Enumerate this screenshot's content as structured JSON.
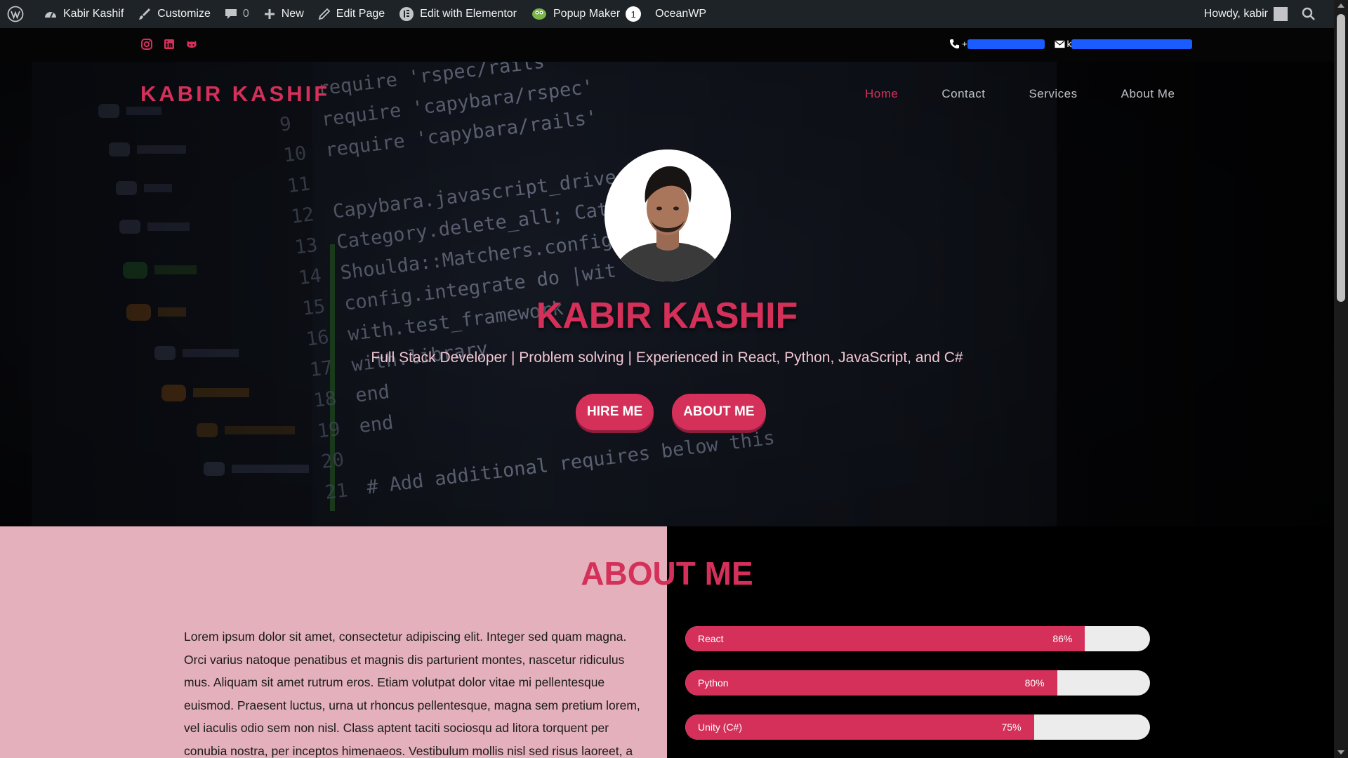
{
  "adminbar": {
    "site_name": "Kabir Kashif",
    "customize": "Customize",
    "comments_count": "0",
    "new": "New",
    "edit_page": "Edit Page",
    "edit_elementor": "Edit with Elementor",
    "popup_maker": "Popup Maker",
    "popup_count": "1",
    "oceanwp": "OceanWP",
    "howdy": "Howdy, kabir",
    "icons": [
      "wordpress-icon",
      "dashboard-icon",
      "brush-icon",
      "comment-icon",
      "plus-icon",
      "pencil-icon",
      "elementor-icon",
      "popup-maker-icon",
      "search-icon"
    ]
  },
  "topbar": {
    "social_icons": [
      "instagram-icon",
      "linkedin-icon",
      "github-icon"
    ],
    "phone_prefix": "+",
    "email_prefix": "k"
  },
  "header": {
    "brand": "KABIR KASHIF",
    "nav": [
      {
        "label": "Home",
        "active": true
      },
      {
        "label": "Contact",
        "active": false
      },
      {
        "label": "Services",
        "active": false
      },
      {
        "label": "About Me",
        "active": false
      }
    ]
  },
  "hero": {
    "title": "KABIR KASHIF",
    "subtitle": "Full Stack Developer | Problem solving | Experienced in React, Python, JavaScript, and C#",
    "hire_button": "HIRE ME",
    "about_button": "ABOUT ME",
    "code_lines": [
      {
        "num": "",
        "text": "require 'rspec/rails'"
      },
      {
        "num": "9",
        "text": "require 'capybara/rspec'"
      },
      {
        "num": "10",
        "text": "require 'capybara/rails'"
      },
      {
        "num": "11",
        "text": ""
      },
      {
        "num": "12",
        "text": "Capybara.javascript_driver = :w"
      },
      {
        "num": "13",
        "text": "Category.delete_all; Category"
      },
      {
        "num": "14",
        "text": "Shoulda::Matchers.configure do"
      },
      {
        "num": "15",
        "text": "config.integrate do |wit"
      },
      {
        "num": "16",
        "text": "with.test_framework"
      },
      {
        "num": "17",
        "text": "with.library"
      },
      {
        "num": "18",
        "text": "end"
      },
      {
        "num": "19",
        "text": "end"
      },
      {
        "num": "20",
        "text": ""
      },
      {
        "num": "21",
        "text": "# Add additional requires below this"
      }
    ]
  },
  "about": {
    "title": "ABOUT ME",
    "text": "Lorem ipsum dolor sit amet, consectetur adipiscing elit. Integer sed quam magna. Orci varius natoque penatibus et magnis dis parturient montes, nascetur ridiculus mus. Aliquam sit amet rutrum eros. Etiam volutpat dolor vitae mi pellentesque euismod. Praesent luctus, urna ut rhoncus pellentesque, magna sem pretium lorem, vel iaculis odio sem non nisl. Class aptent taciti sociosqu ad litora torquent per conubia nostra, per inceptos himenaeos. Vestibulum mollis nisl sed risus laoreet, a",
    "skills": [
      {
        "name": "React",
        "percent": 86,
        "label": "86%"
      },
      {
        "name": "Python",
        "percent": 80,
        "label": "80%"
      },
      {
        "name": "Unity (C#)",
        "percent": 75,
        "label": "75%"
      }
    ]
  },
  "colors": {
    "accent": "#d4305a",
    "about_left_bg": "#e3b0bb",
    "adminbar_bg": "#1d2327",
    "skill_track": "#ececec"
  }
}
